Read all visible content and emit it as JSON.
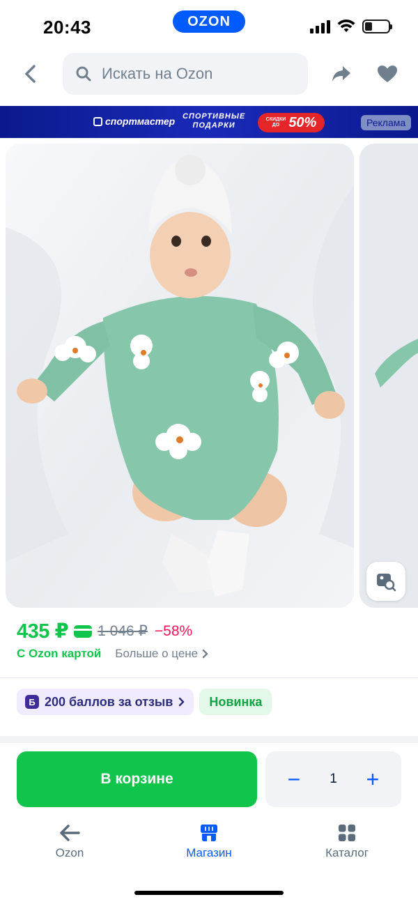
{
  "status_bar": {
    "time": "20:43",
    "brand": "OZON",
    "battery_level": 0.3,
    "icons": [
      "signal-icon",
      "wifi-icon",
      "battery-icon"
    ]
  },
  "header": {
    "search_placeholder": "Искать на Ozon",
    "icons": [
      "back-arrow-icon",
      "search-icon",
      "share-icon",
      "heart-icon"
    ]
  },
  "ad_banner": {
    "brand": "спортмастер",
    "slogan_line1": "СПОРТИВНЫЕ",
    "slogan_line2": "ПОДАРКИ",
    "discount_small_line1": "СКИДКИ",
    "discount_small_line2": "ДО",
    "discount_value": "50%",
    "label": "Реклама"
  },
  "gallery": {
    "visual_search_icon": "visual-search-icon"
  },
  "price": {
    "current": "435 ₽",
    "old": "1 046 ₽",
    "discount": "−58%",
    "with_card": "С Ozon картой",
    "more_about_price": "Больше о цене"
  },
  "badges": {
    "reviews_icon_letter": "Б",
    "reviews": "200 баллов за отзыв",
    "new": "Новинка"
  },
  "actions": {
    "cart_label": "В корзине",
    "qty_minus": "−",
    "qty_value": "1",
    "qty_plus": "+"
  },
  "tabbar": {
    "items": [
      {
        "label": "Ozon",
        "icon": "back-arrow-icon",
        "active": false
      },
      {
        "label": "Магазин",
        "icon": "shop-icon",
        "active": true
      },
      {
        "label": "Каталог",
        "icon": "catalog-grid-icon",
        "active": false
      }
    ]
  },
  "colors": {
    "brand_blue": "#005bff",
    "price_green": "#10c44c",
    "discount_pink": "#f91155",
    "ad_background": "#0a1a8c"
  }
}
